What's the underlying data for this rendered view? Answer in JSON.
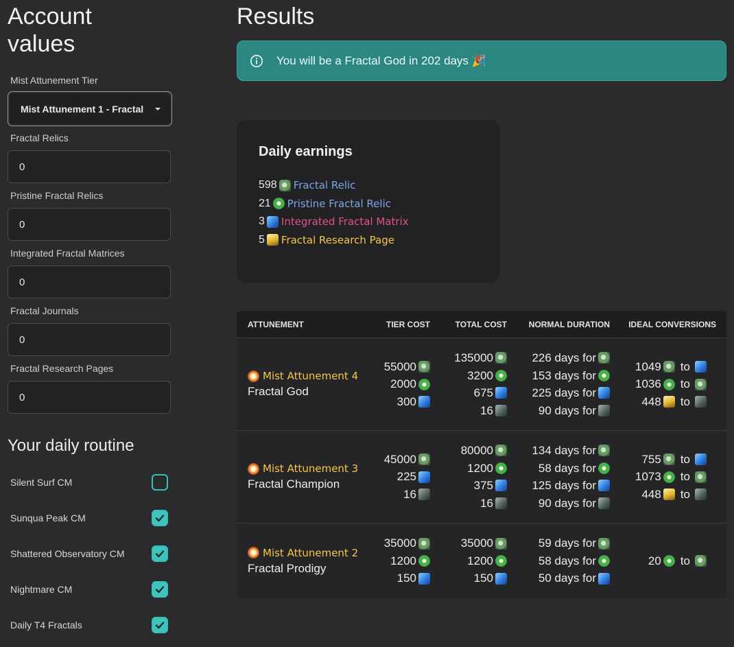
{
  "left": {
    "title": "Account values",
    "tier_label": "Mist Attunement Tier",
    "tier_value": "Mist Attunement 1 - Fractal",
    "fields": [
      {
        "label": "Fractal Relics",
        "value": "0"
      },
      {
        "label": "Pristine Fractal Relics",
        "value": "0"
      },
      {
        "label": "Integrated Fractal Matrices",
        "value": "0"
      },
      {
        "label": "Fractal Journals",
        "value": "0"
      },
      {
        "label": "Fractal Research Pages",
        "value": "0"
      }
    ],
    "routine_title": "Your daily routine",
    "routine": [
      {
        "label": "Silent Surf CM",
        "checked": false
      },
      {
        "label": "Sunqua Peak CM",
        "checked": true
      },
      {
        "label": "Shattered Observatory CM",
        "checked": true
      },
      {
        "label": "Nightmare CM",
        "checked": true
      },
      {
        "label": "Daily T4 Fractals",
        "checked": true
      }
    ]
  },
  "results": {
    "title": "Results",
    "alert": "You will be a Fractal God in 202 days 🎉"
  },
  "daily": {
    "title": "Daily earnings",
    "items": [
      {
        "amount": "598",
        "name": "Fractal Relic",
        "icon": "relic",
        "color": "#7aa6e8"
      },
      {
        "amount": "21",
        "name": "Pristine Fractal Relic",
        "icon": "pristine",
        "color": "#7aa6e8"
      },
      {
        "amount": "3",
        "name": "Integrated Fractal Matrix",
        "icon": "matrix",
        "color": "#e0508a"
      },
      {
        "amount": "5",
        "name": "Fractal Research Page",
        "icon": "page",
        "color": "#f4c842"
      }
    ]
  },
  "table": {
    "headers": [
      "ATTUNEMENT",
      "TIER COST",
      "TOTAL COST",
      "NORMAL DURATION",
      "IDEAL CONVERSIONS"
    ],
    "rows": [
      {
        "tier": "Mist Attunement 4",
        "title": "Fractal God",
        "tier_cost": [
          {
            "v": "55000",
            "icon": "relic"
          },
          {
            "v": "2000",
            "icon": "pristine"
          },
          {
            "v": "300",
            "icon": "matrix"
          }
        ],
        "total_cost": [
          {
            "v": "135000",
            "icon": "relic"
          },
          {
            "v": "3200",
            "icon": "pristine"
          },
          {
            "v": "675",
            "icon": "matrix"
          },
          {
            "v": "16",
            "icon": "journal"
          }
        ],
        "duration": [
          {
            "v": "226 days for",
            "icon": "relic"
          },
          {
            "v": "153 days for",
            "icon": "pristine"
          },
          {
            "v": "225 days for",
            "icon": "matrix"
          },
          {
            "v": "90 days for",
            "icon": "journal"
          }
        ],
        "conversions": [
          {
            "v": "1049",
            "from": "relic",
            "to": "matrix"
          },
          {
            "v": "1036",
            "from": "pristine",
            "to": "relic"
          },
          {
            "v": "448",
            "from": "page",
            "to": "journal"
          }
        ]
      },
      {
        "tier": "Mist Attunement 3",
        "title": "Fractal Champion",
        "tier_cost": [
          {
            "v": "45000",
            "icon": "relic"
          },
          {
            "v": "225",
            "icon": "matrix"
          },
          {
            "v": "16",
            "icon": "journal"
          }
        ],
        "total_cost": [
          {
            "v": "80000",
            "icon": "relic"
          },
          {
            "v": "1200",
            "icon": "pristine"
          },
          {
            "v": "375",
            "icon": "matrix"
          },
          {
            "v": "16",
            "icon": "journal"
          }
        ],
        "duration": [
          {
            "v": "134 days for",
            "icon": "relic"
          },
          {
            "v": "58 days for",
            "icon": "pristine"
          },
          {
            "v": "125 days for",
            "icon": "matrix"
          },
          {
            "v": "90 days for",
            "icon": "journal"
          }
        ],
        "conversions": [
          {
            "v": "755",
            "from": "relic",
            "to": "matrix"
          },
          {
            "v": "1073",
            "from": "pristine",
            "to": "relic"
          },
          {
            "v": "448",
            "from": "page",
            "to": "journal"
          }
        ]
      },
      {
        "tier": "Mist Attunement 2",
        "title": "Fractal Prodigy",
        "tier_cost": [
          {
            "v": "35000",
            "icon": "relic"
          },
          {
            "v": "1200",
            "icon": "pristine"
          },
          {
            "v": "150",
            "icon": "matrix"
          }
        ],
        "total_cost": [
          {
            "v": "35000",
            "icon": "relic"
          },
          {
            "v": "1200",
            "icon": "pristine"
          },
          {
            "v": "150",
            "icon": "matrix"
          }
        ],
        "duration": [
          {
            "v": "59 days for",
            "icon": "relic"
          },
          {
            "v": "58 days for",
            "icon": "pristine"
          },
          {
            "v": "50 days for",
            "icon": "matrix"
          }
        ],
        "conversions": [
          {
            "v": "20",
            "from": "pristine",
            "to": "relic"
          }
        ]
      }
    ]
  }
}
